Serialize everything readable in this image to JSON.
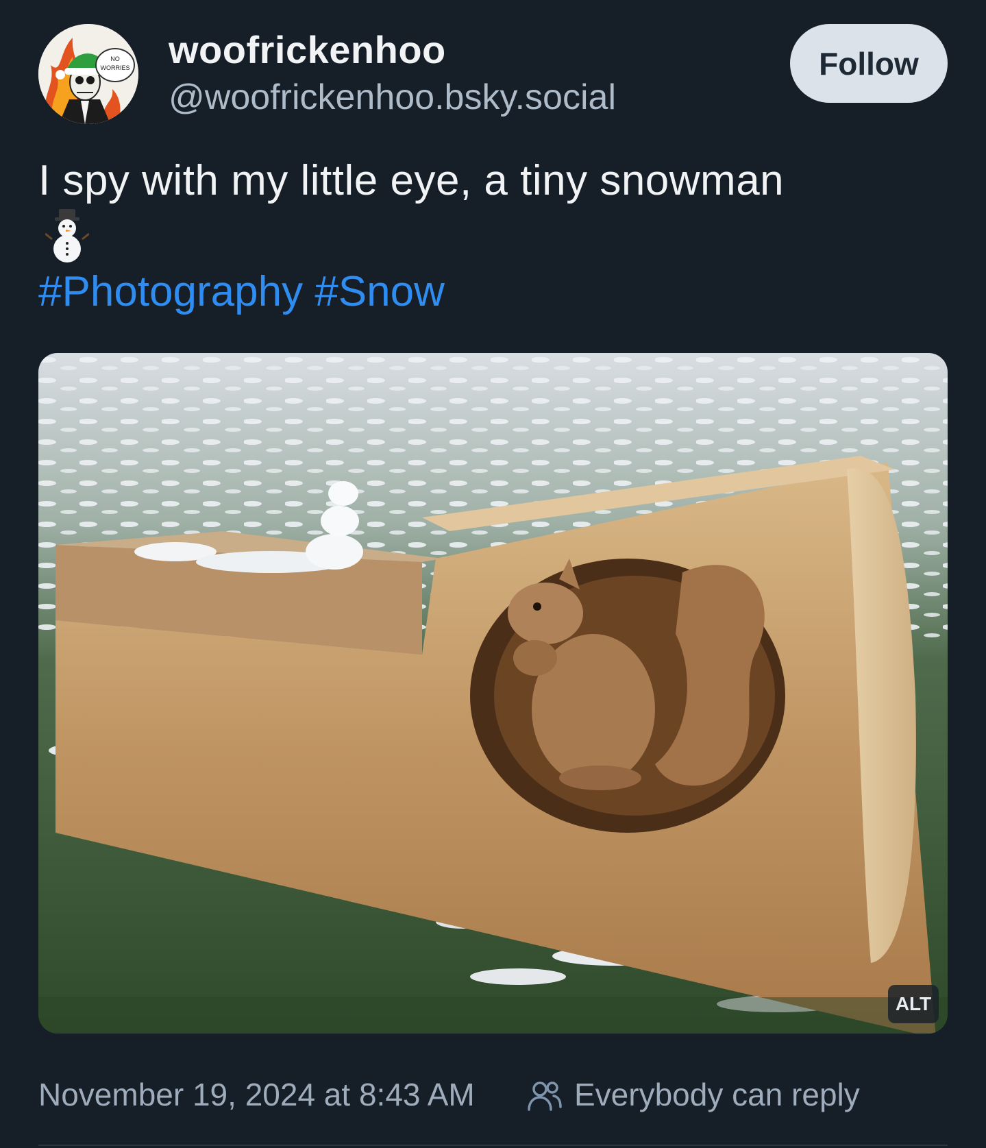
{
  "author": {
    "display_name": "woofrickenhoo",
    "handle": "@woofrickenhoo.bsky.social",
    "avatar_icon": "skull-avatar-icon",
    "avatar_sign_line1": "NO",
    "avatar_sign_line2": "WORRIES"
  },
  "follow_button": {
    "label": "Follow"
  },
  "post": {
    "text": "I spy with my little eye, a tiny snowman",
    "emoji": "snowman-emoji",
    "hashtags": [
      "#Photography",
      "#Snow"
    ]
  },
  "image": {
    "alt_badge": "ALT",
    "description_icon": "carved-squirrel-bench-photo"
  },
  "footer": {
    "timestamp": "November 19, 2024 at 8:43 AM",
    "reply_setting": "Everybody can reply",
    "reply_icon": "people-icon"
  },
  "colors": {
    "background": "#161e27",
    "text": "#f1f3f5",
    "muted": "#9eacbb",
    "link": "#2f8df2",
    "button_bg": "#dce2ea"
  }
}
